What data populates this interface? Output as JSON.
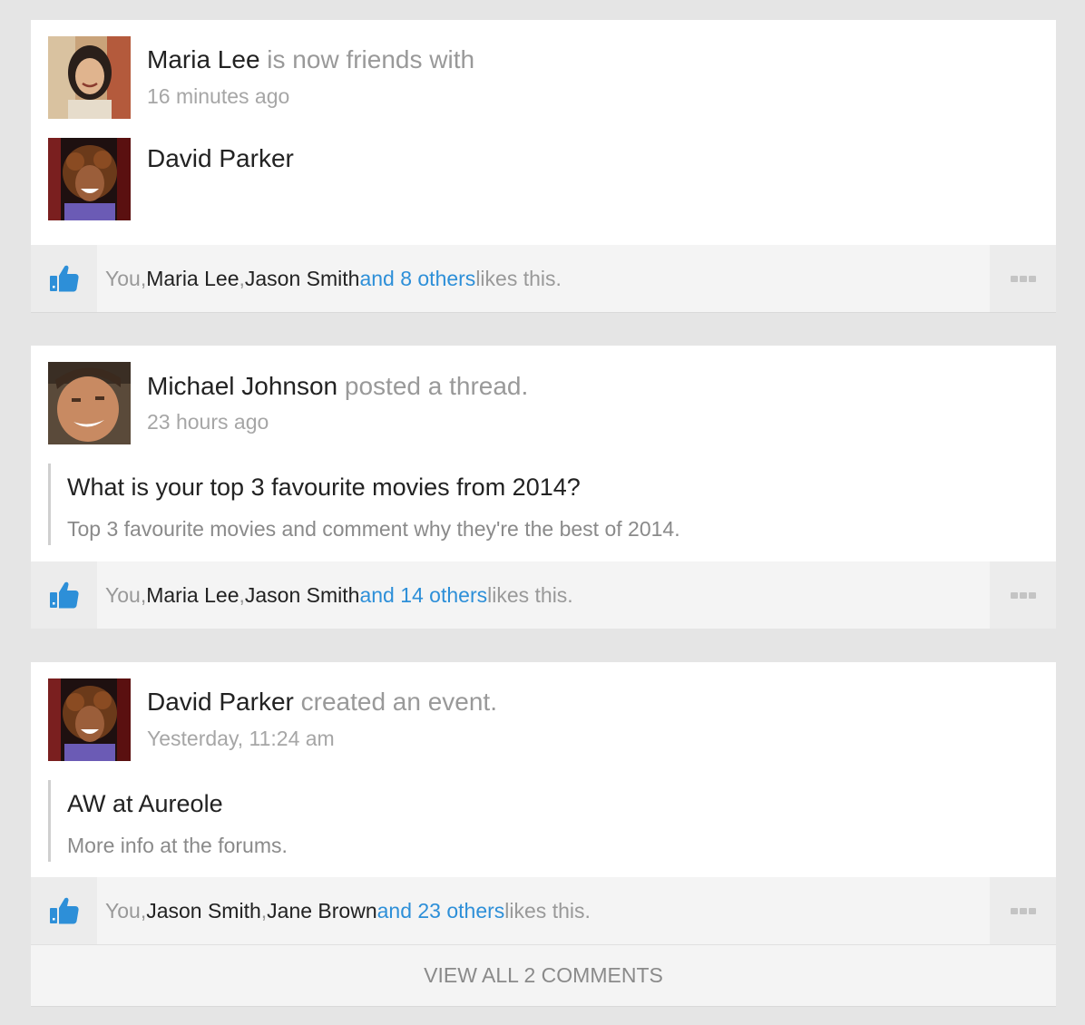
{
  "posts": [
    {
      "actor": "Maria Lee",
      "action": " is now friends with",
      "time": "16 minutes ago",
      "friend": "David Parker",
      "likes": {
        "prefix": "You, ",
        "name1": "Maria Lee",
        "sep": ", ",
        "name2": "Jason Smith",
        "others": " and 8 others",
        "suffix": " likes this."
      }
    },
    {
      "actor": "Michael Johnson",
      "action": " posted a thread.",
      "time": "23 hours ago",
      "quote_title": "What is your top 3 favourite movies from 2014?",
      "quote_body": "Top 3 favourite movies and comment why they're the best of 2014.",
      "likes": {
        "prefix": "You, ",
        "name1": "Maria Lee",
        "sep": ", ",
        "name2": "Jason Smith",
        "others": " and 14 others",
        "suffix": " likes this."
      }
    },
    {
      "actor": "David Parker",
      "action": " created an event.",
      "time": "Yesterday, 11:24 am",
      "quote_title": "AW at Aureole",
      "quote_body": "More info at the forums.",
      "likes": {
        "prefix": "You, ",
        "name1": "Jason Smith",
        "sep": ", ",
        "name2": "Jane Brown",
        "others": " and 23 others",
        "suffix": " likes this."
      },
      "view_all": "VIEW ALL 2 COMMENTS"
    }
  ],
  "colors": {
    "link": "#2d8fd8",
    "like_icon": "#2d8fd8",
    "page_bg": "#e5e5e5"
  },
  "icons": {
    "like": "thumbs-up-icon",
    "more": "ellipsis-icon"
  }
}
